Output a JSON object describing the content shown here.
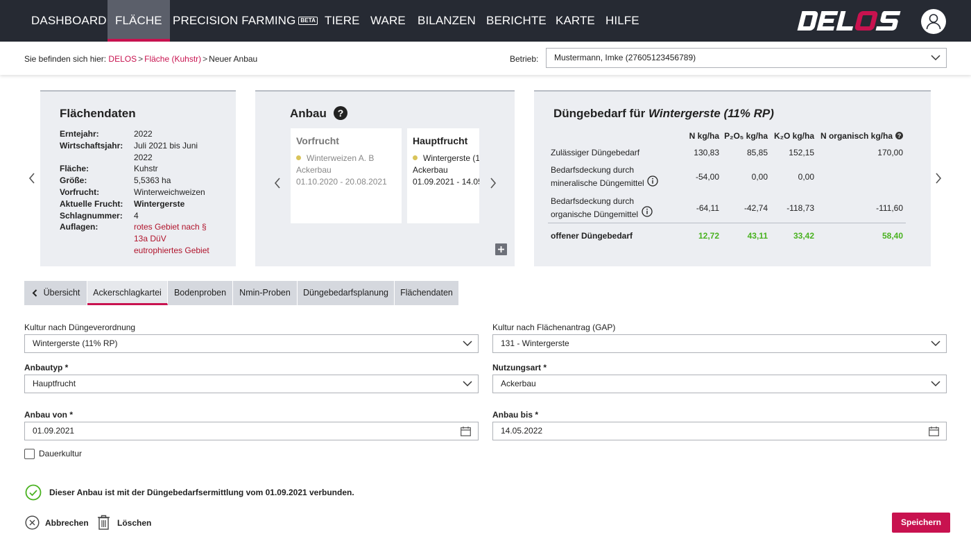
{
  "nav": {
    "items": [
      "DASHBOARD",
      "FLÄCHE",
      "PRECISION FARMING",
      "TIERE",
      "WARE",
      "BILANZEN",
      "BERICHTE",
      "KARTE",
      "HILFE"
    ],
    "beta_badge": "BETA",
    "active_index": 1,
    "logo_text": "DELOS",
    "colors": {
      "bg": "#262a33",
      "accent": "#c8124f"
    }
  },
  "breadcrumb": {
    "prefix": "Sie befinden sich hier:",
    "items": [
      "DELOS",
      "Fläche (Kuhstr)",
      "Neuer Anbau"
    ],
    "separator": ">"
  },
  "betrieb": {
    "label": "Betrieb:",
    "value": "Mustermann, Imke (27605123456789)"
  },
  "flaechendaten": {
    "title": "Flächendaten",
    "rows": [
      {
        "key": "Erntejahr:",
        "value": "2022"
      },
      {
        "key": "Wirtschaftsjahr:",
        "value": "Juli 2021 bis Juni 2022"
      },
      {
        "key": "Fläche:",
        "value": "Kuhstr"
      },
      {
        "key": "Größe:",
        "value": "5,5363 ha"
      },
      {
        "key": "Vorfrucht:",
        "value": "Winterweichweizen"
      },
      {
        "key": "Aktuelle Frucht:",
        "value": "Wintergerste"
      },
      {
        "key": "Schlagnummer:",
        "value": "4"
      },
      {
        "key": "Auflagen:",
        "value": "rotes Gebiet nach § 13a DüV"
      },
      {
        "key": "",
        "value": "eutrophiertes Gebiet"
      }
    ]
  },
  "anbau": {
    "title": "Anbau",
    "help_icon": "help-circle-icon",
    "vorfrucht": {
      "title": "Vorfrucht",
      "crop": "Winterweizen A. B",
      "type": "Ackerbau",
      "period": "01.10.2020 - 20.08.2021"
    },
    "hauptfrucht": {
      "title": "Hauptfrucht",
      "crop": "Wintergerste (1",
      "type": "Ackerbau",
      "period": "01.09.2021 - 14.05"
    }
  },
  "duengebedarf": {
    "title_prefix": "Düngebedarf für",
    "title_crop": "Wintergerste (11% RP)",
    "columns": [
      "N kg/ha",
      "P₂O₅ kg/ha",
      "K₂O kg/ha",
      "N organisch kg/ha"
    ],
    "rows": [
      {
        "label": "Zulässiger Düngebedarf",
        "values": [
          "130,83",
          "85,85",
          "152,15",
          "170,00"
        ]
      },
      {
        "label": "Bedarfsdeckung durch",
        "label2": "mineralische Düngemittel",
        "values": [
          "-54,00",
          "0,00",
          "0,00",
          ""
        ]
      },
      {
        "label": "Bedarfsdeckung durch",
        "label2": "organische Düngemittel",
        "values": [
          "-64,11",
          "-42,74",
          "-118,73",
          "-111,60"
        ]
      }
    ],
    "total": {
      "label": "offener Düngebedarf",
      "values": [
        "12,72",
        "43,11",
        "33,42",
        "58,40"
      ]
    }
  },
  "tabs": [
    "Übersicht",
    "Ackerschlagkartei",
    "Bodenproben",
    "Nmin-Proben",
    "Düngebedarfsplanung",
    "Flächendaten"
  ],
  "form": {
    "kultur_dv_label": "Kultur nach Düngeverordnung",
    "kultur_dv_value": "Wintergerste (11% RP)",
    "kultur_gap_label": "Kultur nach Flächenantrag (GAP)",
    "kultur_gap_value": "131 - Wintergerste",
    "anbautyp_label": "Anbautyp *",
    "anbautyp_value": "Hauptfrucht",
    "nutzungsart_label": "Nutzungsart *",
    "nutzungsart_value": "Ackerbau",
    "anbau_von_label": "Anbau von *",
    "anbau_von_value": "01.09.2021",
    "anbau_bis_label": "Anbau bis *",
    "anbau_bis_value": "14.05.2022",
    "dauerkultur_label": "Dauerkultur",
    "dauerkultur_checked": false
  },
  "notice": "Dieser Anbau ist mit der Düngebedarfsermittlung vom 01.09.2021 verbunden.",
  "actions": {
    "cancel": "Abbrechen",
    "delete": "Löschen",
    "save": "Speichern"
  }
}
